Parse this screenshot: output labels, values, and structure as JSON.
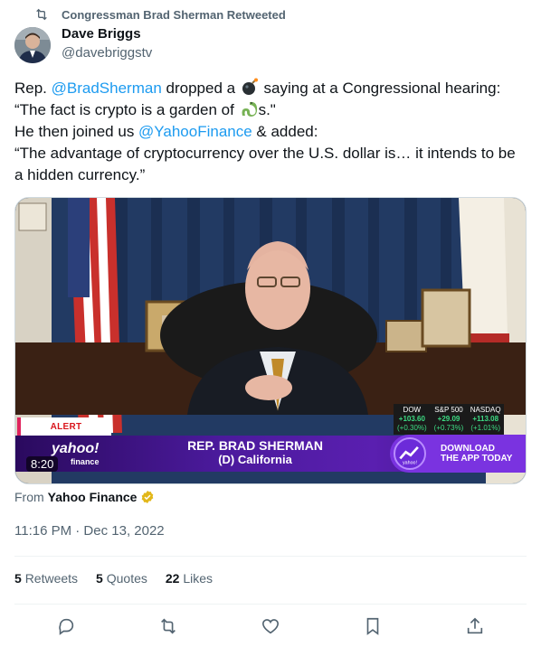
{
  "retweet": {
    "text": "Congressman Brad Sherman Retweeted",
    "icon": "retweet-icon"
  },
  "author": {
    "name": "Dave Briggs",
    "handle": "@davebriggstv"
  },
  "tweet": {
    "l1_pre": "Rep. ",
    "l1_mention": "@BradSherman",
    "l1_mid": " dropped a ",
    "l1_post": " saying at a Congressional hearing:",
    "l2_pre": "“The fact is crypto is a garden of ",
    "l2_post": "s.\"",
    "l3_pre": "He then joined us ",
    "l3_mention": "@YahooFinance",
    "l3_post": " & added:",
    "l4": "“The advantage of cryptocurrency over the U.S. dollar is… it intends to be",
    "l5": "a hidden currency.”",
    "emoji_bomb": "bomb-emoji",
    "emoji_snake": "snake-emoji"
  },
  "media": {
    "alert": "ALERT",
    "brand": "yahoo!",
    "brand_sub": "finance",
    "name": "REP. BRAD SHERMAN",
    "party": "(D) California",
    "promo_l1": "DOWNLOAD",
    "promo_l2": "THE APP TODAY",
    "promo_brand": "yahoo!",
    "duration": "8:20",
    "ticker": [
      {
        "label": "DOW",
        "change": "+103.60",
        "pct": "(+0.30%)"
      },
      {
        "label": "S&P 500",
        "change": "+29.09",
        "pct": "(+0.73%)"
      },
      {
        "label": "NASDAQ",
        "change": "+113.08",
        "pct": "(+1.01%)"
      }
    ]
  },
  "source": {
    "prefix": "From",
    "name": "Yahoo Finance"
  },
  "timestamp": "11:16 PM · Dec 13, 2022",
  "stats": {
    "retweets_count": "5",
    "retweets_label": "Retweets",
    "quotes_count": "5",
    "quotes_label": "Quotes",
    "likes_count": "22",
    "likes_label": "Likes"
  },
  "actions": [
    "reply-icon",
    "retweet-icon",
    "like-icon",
    "bookmark-icon",
    "share-icon"
  ],
  "colors": {
    "link": "#1d9bf0",
    "muted": "#536471",
    "accent": "#7a33e0",
    "gold": "#e2b719"
  }
}
